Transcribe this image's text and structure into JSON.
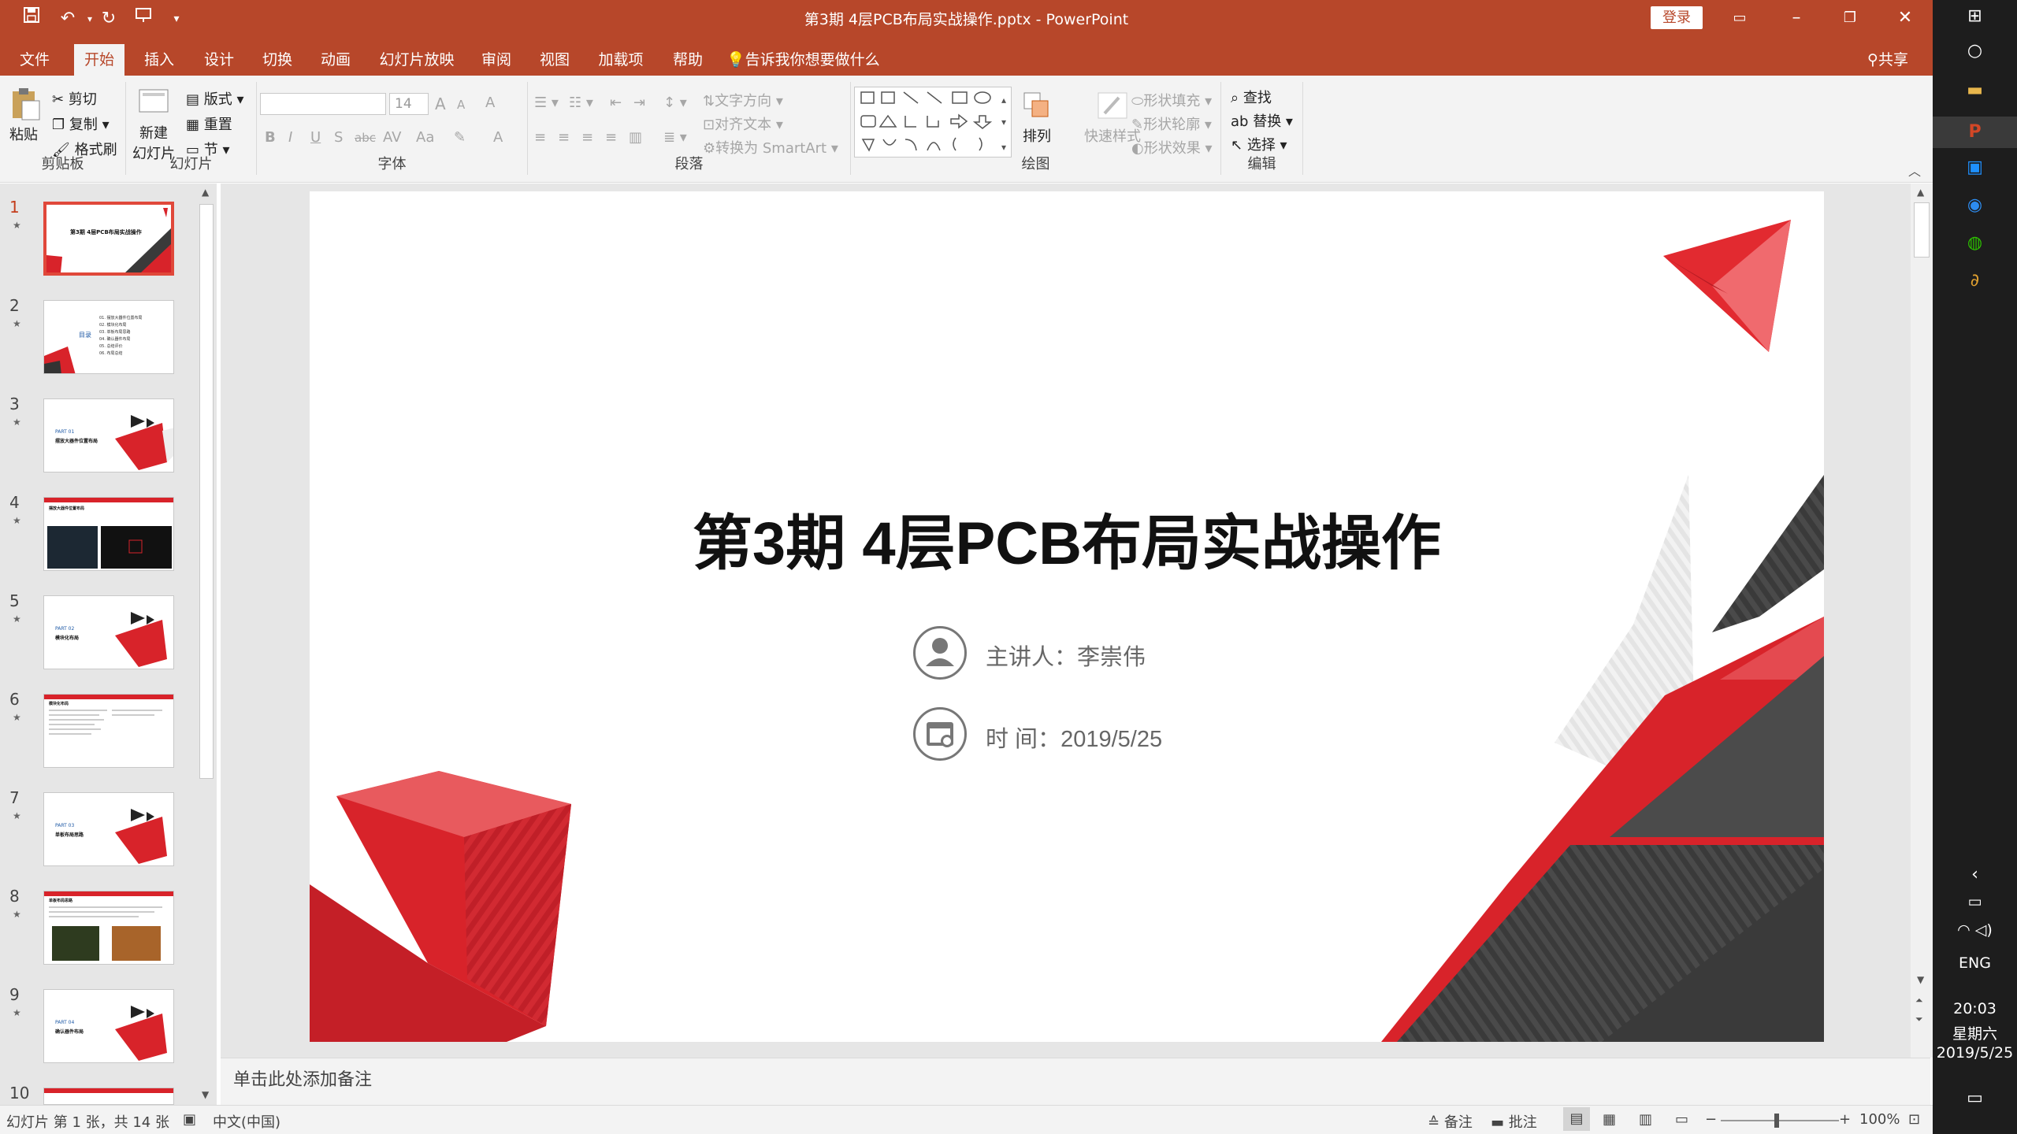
{
  "window": {
    "title": "第3期 4层PCB布局实战操作.pptx  -  PowerPoint",
    "login_label": "登录",
    "share_label": "共享",
    "qat": [
      "save-icon",
      "undo-icon",
      "redo-icon",
      "start-slideshow-icon",
      "customize-icon"
    ]
  },
  "tabs": [
    "文件",
    "开始",
    "插入",
    "设计",
    "切换",
    "动画",
    "幻灯片放映",
    "审阅",
    "视图",
    "加载项",
    "帮助"
  ],
  "tell_me": "告诉我你想要做什么",
  "ribbon": {
    "clipboard": {
      "label": "剪贴板",
      "paste": "粘贴",
      "cut": "剪切",
      "copy": "复制",
      "format_painter": "格式刷"
    },
    "slides": {
      "label": "幻灯片",
      "new_slide_1": "新建",
      "new_slide_2": "幻灯片",
      "layout": "版式",
      "reset": "重置",
      "section": "节"
    },
    "font": {
      "label": "字体",
      "font_name": "",
      "font_size": "14",
      "bold": "B",
      "italic": "I",
      "underline": "U",
      "strike": "S",
      "shadow": "abc",
      "spacing": "AV",
      "case": "Aa",
      "grow": "A",
      "shrink": "A",
      "clear": "A",
      "color": "A"
    },
    "paragraph": {
      "label": "段落",
      "text_direction": "文字方向",
      "align_text": "对齐文本",
      "smartart": "转换为 SmartArt"
    },
    "drawing": {
      "label": "绘图",
      "arrange": "排列",
      "quick_styles": "快速样式",
      "shape_fill": "形状填充",
      "shape_outline": "形状轮廓",
      "shape_effects": "形状效果"
    },
    "editing": {
      "label": "编辑",
      "find": "查找",
      "replace": "替换",
      "select": "选择"
    }
  },
  "thumbnails": [
    {
      "num": "1",
      "title": "第3期 4层PCB布局实战操作"
    },
    {
      "num": "2",
      "section": "目录",
      "items": [
        "01. 摆放大器件位置布局",
        "02. 模块化布局",
        "03. 单板布局思路",
        "04. 确认器件布局",
        "05. 总结评价",
        "06. 布局总结"
      ]
    },
    {
      "num": "3",
      "part": "PART 01",
      "title": "摆放大器件位置布局"
    },
    {
      "num": "4",
      "title": "摆放大器件位置布局"
    },
    {
      "num": "5",
      "part": "PART 02",
      "title": "模块化布局"
    },
    {
      "num": "6",
      "title": "模块化布局"
    },
    {
      "num": "7",
      "part": "PART 03",
      "title": "单板布局思路"
    },
    {
      "num": "8",
      "title": "单板布局思路"
    },
    {
      "num": "9",
      "part": "PART 04",
      "title": "确认器件布局"
    },
    {
      "num": "10",
      "title": ""
    }
  ],
  "slide": {
    "title": "第3期  4层PCB布局实战操作",
    "presenter": "主讲人：李崇伟",
    "date_label": "时   间：",
    "date": "2019/5/25"
  },
  "notes_placeholder": "单击此处添加备注",
  "status": {
    "slide_info": "幻灯片 第 1 张，共 14 张",
    "language": "中文(中国)",
    "notes": "备注",
    "comments": "批注",
    "zoom": "100%",
    "zoom_level": 1.0
  },
  "taskbar": {
    "lang": "ENG",
    "time": "20:03",
    "weekday": "星期六",
    "date": "2019/5/25"
  },
  "colors": {
    "accent": "#b7472a",
    "slide_red": "#d8232a",
    "slide_dark": "#3a3a3a",
    "selection": "#e0483a"
  }
}
